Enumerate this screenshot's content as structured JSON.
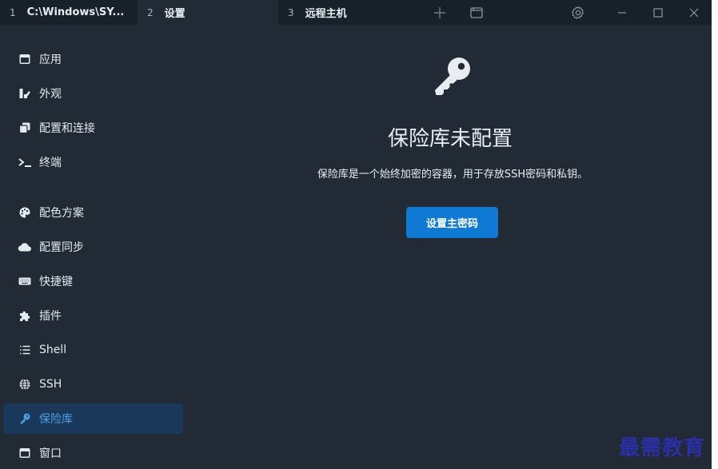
{
  "tabs": [
    {
      "num": "1",
      "label": "C:\\Windows\\SY..."
    },
    {
      "num": "2",
      "label": "设置"
    },
    {
      "num": "3",
      "label": "远程主机"
    }
  ],
  "titlebar_icons": [
    "plus-icon",
    "window-icon",
    "gear-icon",
    "minimize-icon",
    "maximize-icon",
    "close-icon"
  ],
  "sidebar": {
    "items": [
      {
        "label": "应用",
        "icon": "window-icon"
      },
      {
        "label": "外观",
        "icon": "paint-icon"
      },
      {
        "label": "配置和连接",
        "icon": "copy-icon"
      },
      {
        "label": "终端",
        "icon": "terminal-icon"
      },
      {
        "label": "配色方案",
        "icon": "palette-icon"
      },
      {
        "label": "配置同步",
        "icon": "cloud-icon"
      },
      {
        "label": "快捷键",
        "icon": "keyboard-icon"
      },
      {
        "label": "插件",
        "icon": "puzzle-icon"
      },
      {
        "label": "Shell",
        "icon": "list-icon"
      },
      {
        "label": "SSH",
        "icon": "globe-icon"
      },
      {
        "label": "保险库",
        "icon": "key-icon",
        "active": true
      },
      {
        "label": "窗口",
        "icon": "window-icon"
      }
    ]
  },
  "main": {
    "title": "保险库未配置",
    "description": "保险库是一个始终加密的容器，用于存放SSH密码和私钥。",
    "button_label": "设置主密码",
    "icon": "key-icon"
  },
  "watermark": "最需教育",
  "colors": {
    "background": "#212a35",
    "tabbar": "#18202a",
    "accent": "#0f79d3",
    "active_item_bg": "#19385a",
    "active_item_text": "#4c9fe6"
  }
}
